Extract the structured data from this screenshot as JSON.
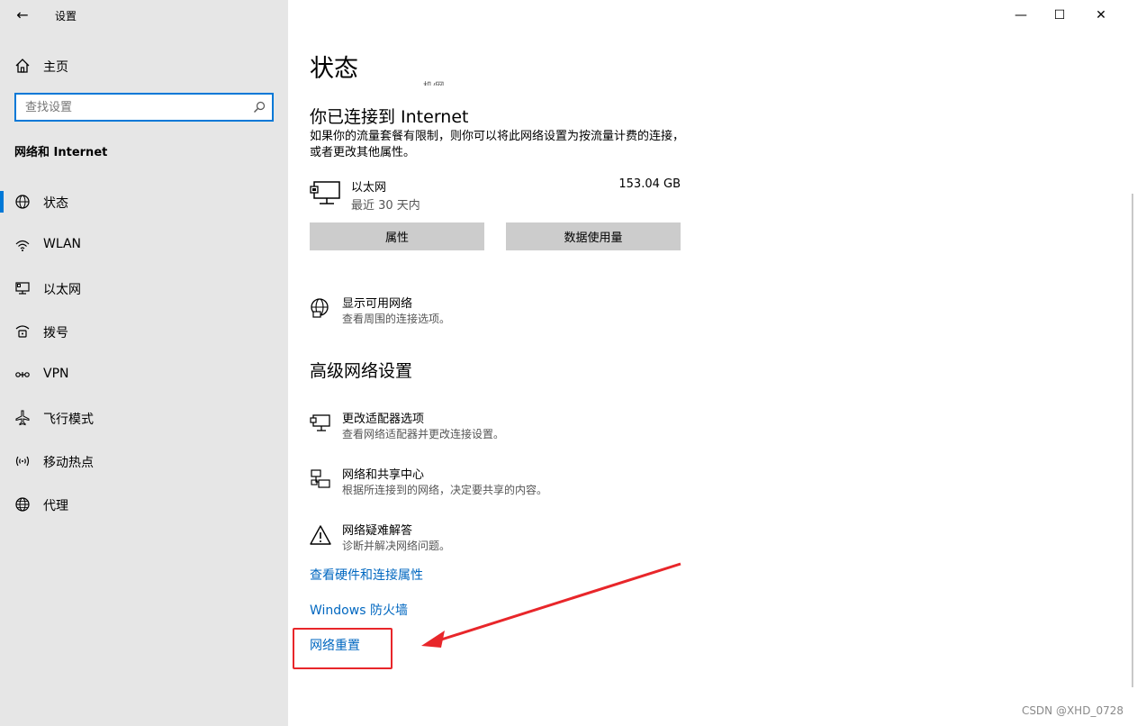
{
  "window": {
    "app_title": "设置",
    "controls": {
      "minimize": "—",
      "maximize": "☐",
      "close": "✕"
    }
  },
  "sidebar": {
    "back_label": "←",
    "home_label": "主页",
    "search_placeholder": "查找设置",
    "section_label": "网络和 Internet",
    "items": [
      {
        "label": "状态",
        "icon": "globe-icon",
        "active": true
      },
      {
        "label": "WLAN",
        "icon": "wifi-icon",
        "active": false
      },
      {
        "label": "以太网",
        "icon": "ethernet-icon",
        "active": false
      },
      {
        "label": "拨号",
        "icon": "dialup-icon",
        "active": false
      },
      {
        "label": "VPN",
        "icon": "vpn-icon",
        "active": false
      },
      {
        "label": "飞行模式",
        "icon": "airplane-icon",
        "active": false
      },
      {
        "label": "移动热点",
        "icon": "hotspot-icon",
        "active": false
      },
      {
        "label": "代理",
        "icon": "proxy-globe-icon",
        "active": false
      }
    ]
  },
  "main": {
    "page_title": "状态",
    "cut_text": "机/网",
    "connected_heading": "你已连接到 Internet",
    "connected_desc": "如果你的流量套餐有限制，则你可以将此网络设置为按流量计费的连接，或者更改其他属性。",
    "ethernet": {
      "name": "以太网",
      "period": "最近 30 天内",
      "usage": "153.04 GB"
    },
    "buttons": {
      "properties": "属性",
      "data_usage": "数据使用量"
    },
    "show_networks": {
      "title": "显示可用网络",
      "desc": "查看周围的连接选项。"
    },
    "advanced_heading": "高级网络设置",
    "advanced_items": [
      {
        "title": "更改适配器选项",
        "desc": "查看网络适配器并更改连接设置。"
      },
      {
        "title": "网络和共享中心",
        "desc": "根据所连接到的网络，决定要共享的内容。"
      },
      {
        "title": "网络疑难解答",
        "desc": "诊断并解决网络问题。"
      }
    ],
    "links": {
      "hardware": "查看硬件和连接属性",
      "firewall": "Windows 防火墙",
      "reset": "网络重置"
    }
  },
  "colors": {
    "accent": "#0078d7",
    "link": "#0067c0",
    "annotation": "#e8262a",
    "sidebar_bg": "#e6e6e6"
  },
  "watermark": "CSDN @XHD_0728"
}
